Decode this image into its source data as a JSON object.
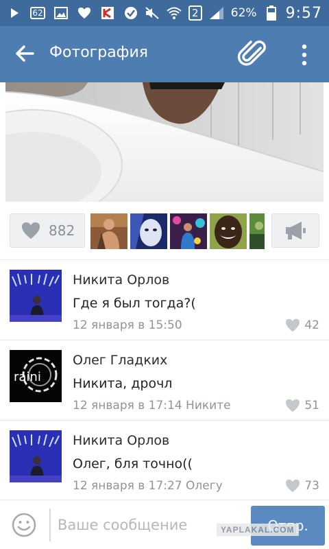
{
  "status_bar": {
    "notification_count": "62",
    "sim_slot": "2",
    "battery_percent": "62%",
    "time": "9:57"
  },
  "app_bar": {
    "title": "Фотография"
  },
  "likes": {
    "count": "882"
  },
  "comments": [
    {
      "author": "Никита Орлов",
      "text": "Где я был тогда?(",
      "meta": "12 января в 15:50",
      "likes": "42"
    },
    {
      "author": "Олег Гладких",
      "text": "Никита, дрочл",
      "meta": "12 января в 17:14 Никите",
      "likes": "51"
    },
    {
      "author": "Никита Орлов",
      "text": "Олег, бля точно((",
      "meta": "12 января в 17:27 Олегу",
      "likes": "73"
    }
  ],
  "composer": {
    "placeholder": "Ваше сообщение",
    "send_label": "Отпр."
  },
  "watermark": "YAPLAKAL.COM",
  "colors": {
    "status_bar": "#3f6b9c",
    "app_bar": "#4d7db1",
    "send_button": "#5b8ac1"
  }
}
